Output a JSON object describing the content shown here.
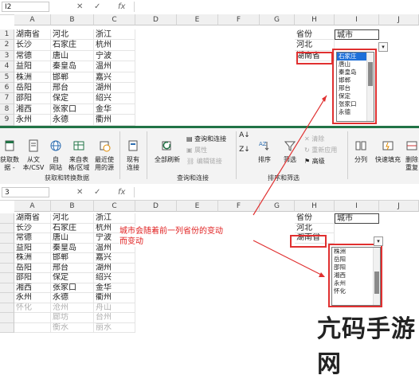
{
  "top": {
    "name_box": "I2",
    "fx": "fx",
    "columns": [
      "A",
      "B",
      "C",
      "D",
      "E",
      "F",
      "G",
      "H",
      "I",
      "J"
    ],
    "rows": [
      {
        "n": "1",
        "a": "湖南省",
        "b": "河北",
        "c": "浙江"
      },
      {
        "n": "2",
        "a": "长沙",
        "b": "石家庄",
        "c": "杭州"
      },
      {
        "n": "3",
        "a": "常德",
        "b": "唐山",
        "c": "宁波"
      },
      {
        "n": "4",
        "a": "益阳",
        "b": "秦皇岛",
        "c": "温州"
      },
      {
        "n": "5",
        "a": "株洲",
        "b": "邯郸",
        "c": "嘉兴"
      },
      {
        "n": "6",
        "a": "岳阳",
        "b": "邢台",
        "c": "湖州"
      },
      {
        "n": "7",
        "a": "邵阳",
        "b": "保定",
        "c": "绍兴"
      },
      {
        "n": "8",
        "a": "湘西",
        "b": "张家口",
        "c": "金华"
      },
      {
        "n": "9",
        "a": "永州",
        "b": "永德",
        "c": "衢州"
      }
    ],
    "h1": "省份",
    "i1": "城市",
    "h2": "河北",
    "h3": "湖南省",
    "dropdown": [
      "石家庄",
      "唐山",
      "秦皇岛",
      "邯郸",
      "邢台",
      "保定",
      "张家口",
      "永德"
    ]
  },
  "ribbon": {
    "get_data": "获取数\n据 -",
    "from_csv": "从文\n本/CSV",
    "from_web": "自\n网站",
    "from_table": "来自表\n格/区域",
    "recent": "最近使\n用的源",
    "existing": "现有\n连接",
    "group1": "获取和转换数据",
    "refresh_all": "全部刷新",
    "queries": "查询和连接",
    "properties": "属性",
    "edit_links": "编辑链接",
    "group2": "查询和连接",
    "sort": "排序",
    "filter": "筛选",
    "clear": "清除",
    "reapply": "重新应用",
    "advanced": "高级",
    "group3": "排序和筛选",
    "split": "分列",
    "flash_fill": "快速填充",
    "dedupe": "删除\n重复"
  },
  "bottom": {
    "name_box": "3",
    "fx": "fx",
    "columns": [
      "A",
      "B",
      "C",
      "D",
      "E",
      "F",
      "G",
      "H",
      "I",
      "J"
    ],
    "rows": [
      {
        "a": "湖南省",
        "b": "河北",
        "c": "浙江"
      },
      {
        "a": "长沙",
        "b": "石家庄",
        "c": "杭州"
      },
      {
        "a": "常德",
        "b": "唐山",
        "c": "宁波"
      },
      {
        "a": "益阳",
        "b": "秦皇岛",
        "c": "温州"
      },
      {
        "a": "株洲",
        "b": "邯郸",
        "c": "嘉兴"
      },
      {
        "a": "岳阳",
        "b": "邢台",
        "c": "湖州"
      },
      {
        "a": "邵阳",
        "b": "保定",
        "c": "绍兴"
      },
      {
        "a": "湘西",
        "b": "张家口",
        "c": "金华"
      },
      {
        "a": "永州",
        "b": "永德",
        "c": "衢州"
      },
      {
        "a": "怀化",
        "b": "沧州",
        "c": "舟山"
      },
      {
        "a": "",
        "b": "廊坊",
        "c": "台州"
      },
      {
        "a": "",
        "b": "衡水",
        "c": "丽水"
      }
    ],
    "h1": "省份",
    "i1": "城市",
    "h2": "河北",
    "h3": "湖南省",
    "dropdown": [
      "株洲",
      "岳阳",
      "邵阳",
      "湘西",
      "永州",
      "怀化"
    ]
  },
  "annotation": "城市会随着前一列省份的变动\n而变动",
  "watermark": "亢码手游网",
  "colors": {
    "accent": "#217346",
    "annotation": "#e03030",
    "selection": "#1e6fd9"
  }
}
